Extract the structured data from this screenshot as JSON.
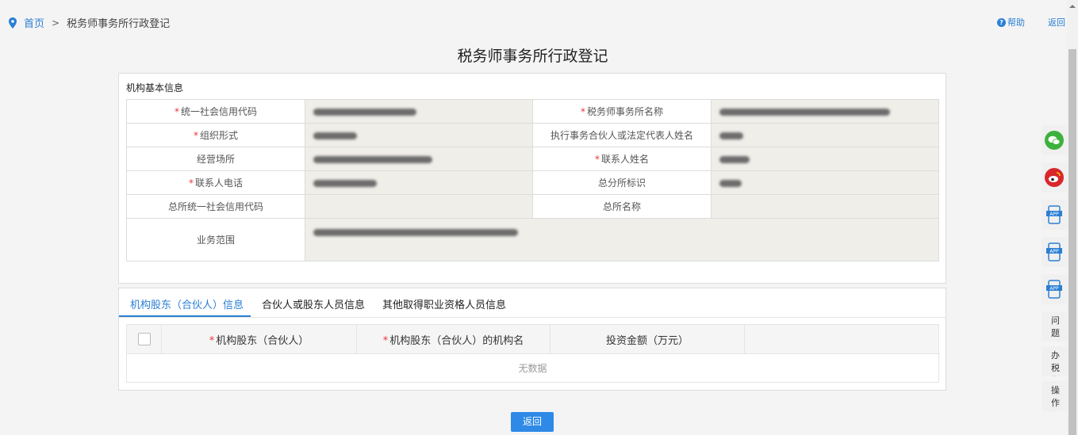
{
  "breadcrumb": {
    "home": "首页",
    "sep": ">",
    "current": "税务师事务所行政登记"
  },
  "header": {
    "help": "帮助",
    "back": "返回"
  },
  "page_title": "税务师事务所行政登记",
  "basic_info": {
    "title": "机构基本信息",
    "fields": {
      "credit_code": "统一社会信用代码",
      "firm_name": "税务师事务所名称",
      "org_form": "组织形式",
      "legal_rep": "执行事务合伙人或法定代表人姓名",
      "premises": "经营场所",
      "contact_name": "联系人姓名",
      "contact_phone": "联系人电话",
      "branch_flag": "总分所标识",
      "hq_credit_code": "总所统一社会信用代码",
      "hq_name": "总所名称",
      "business_scope": "业务范围"
    }
  },
  "tabs": [
    {
      "label": "机构股东（合伙人）信息",
      "active": true
    },
    {
      "label": "合伙人或股东人员信息",
      "active": false
    },
    {
      "label": "其他取得职业资格人员信息",
      "active": false
    }
  ],
  "grid": {
    "columns": [
      "机构股东（合伙人）",
      "机构股东（合伙人）的机构名",
      "投资金额（万元）"
    ],
    "empty_text": "无数据"
  },
  "back_button": "返回",
  "rightbar": {
    "feedback": "问题反馈",
    "guide": "办税指南",
    "procedure": "操作规程"
  },
  "colors": {
    "accent": "#2a7fd4",
    "required": "#e33333",
    "button": "#2e8ae6"
  }
}
